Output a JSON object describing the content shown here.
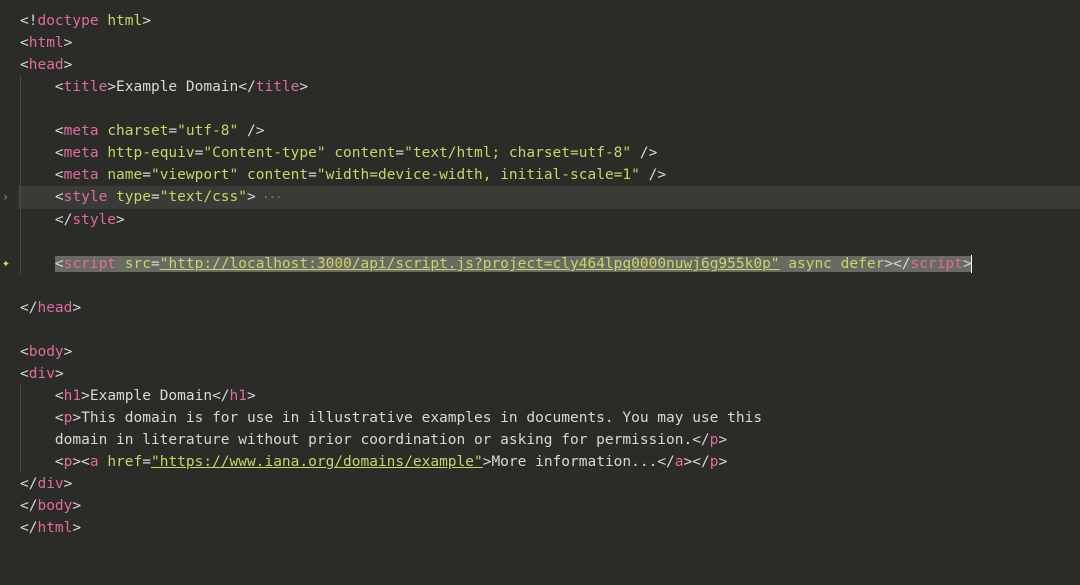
{
  "code": {
    "line1": {
      "punct1": "<!",
      "doctype": "doctype",
      "ws": " ",
      "val": "html",
      "punct2": ">"
    },
    "line2": {
      "lt": "<",
      "tag": "html",
      "gt": ">"
    },
    "line3": {
      "lt": "<",
      "tag": "head",
      "gt": ">"
    },
    "line4": {
      "lt": "<",
      "tag": "title",
      "gt": ">",
      "text": "Example Domain",
      "clt": "</",
      "ctag": "title",
      "cgt": ">"
    },
    "line6": {
      "lt": "<",
      "tag": "meta",
      "attr1": "charset",
      "eq": "=",
      "val1": "\"utf-8\"",
      "end": " />"
    },
    "line7": {
      "lt": "<",
      "tag": "meta",
      "attr1": "http-equiv",
      "val1": "\"Content-type\"",
      "attr2": "content",
      "val2": "\"text/html; charset=utf-8\"",
      "end": " />"
    },
    "line8": {
      "lt": "<",
      "tag": "meta",
      "attr1": "name",
      "val1": "\"viewport\"",
      "attr2": "content",
      "val2": "\"width=device-width, initial-scale=1\"",
      "end": " />"
    },
    "line9": {
      "lt": "<",
      "tag": "style",
      "attr1": "type",
      "val1": "\"text/css\"",
      "gt": ">",
      "dots": " ···"
    },
    "line10": {
      "clt": "</",
      "tag": "style",
      "gt": ">"
    },
    "line12": {
      "lt": "<",
      "tag": "script",
      "attr_src": "src",
      "url": "\"http://localhost:3000/api/script.js?project=cly464lpq0000nuwj6g955k0p\"",
      "attr_async": "async",
      "attr_defer": "defer",
      "gt": ">",
      "clt": "</",
      "ctag": "script",
      "cgt": ">"
    },
    "line14": {
      "clt": "</",
      "tag": "head",
      "gt": ">"
    },
    "line16": {
      "lt": "<",
      "tag": "body",
      "gt": ">"
    },
    "line17": {
      "lt": "<",
      "tag": "div",
      "gt": ">"
    },
    "line18": {
      "lt": "<",
      "tag": "h1",
      "gt": ">",
      "text": "Example Domain",
      "clt": "</",
      "ctag": "h1",
      "cgt": ">"
    },
    "line19": {
      "lt": "<",
      "tag": "p",
      "gt": ">",
      "text": "This domain is for use in illustrative examples in documents. You may use this"
    },
    "line20": {
      "text": "domain in literature without prior coordination or asking for permission.",
      "clt": "</",
      "tag": "p",
      "gt": ">"
    },
    "line21": {
      "p_lt": "<",
      "p_tag": "p",
      "p_gt": ">",
      "a_lt": "<",
      "a_tag": "a",
      "a_attr": "href",
      "a_url": "\"https://www.iana.org/domains/example\"",
      "a_gt": ">",
      "a_text": "More information...",
      "a_clt": "</",
      "a_ctag": "a",
      "a_cgt": ">",
      "p_clt": "</",
      "p_ctag": "p",
      "p_cgt": ">"
    },
    "line22": {
      "clt": "</",
      "tag": "div",
      "gt": ">"
    },
    "line23": {
      "clt": "</",
      "tag": "body",
      "gt": ">"
    },
    "line24": {
      "clt": "</",
      "tag": "html",
      "gt": ">"
    }
  },
  "gutter": {
    "fold_marker": "›",
    "sparkle": "✦"
  }
}
